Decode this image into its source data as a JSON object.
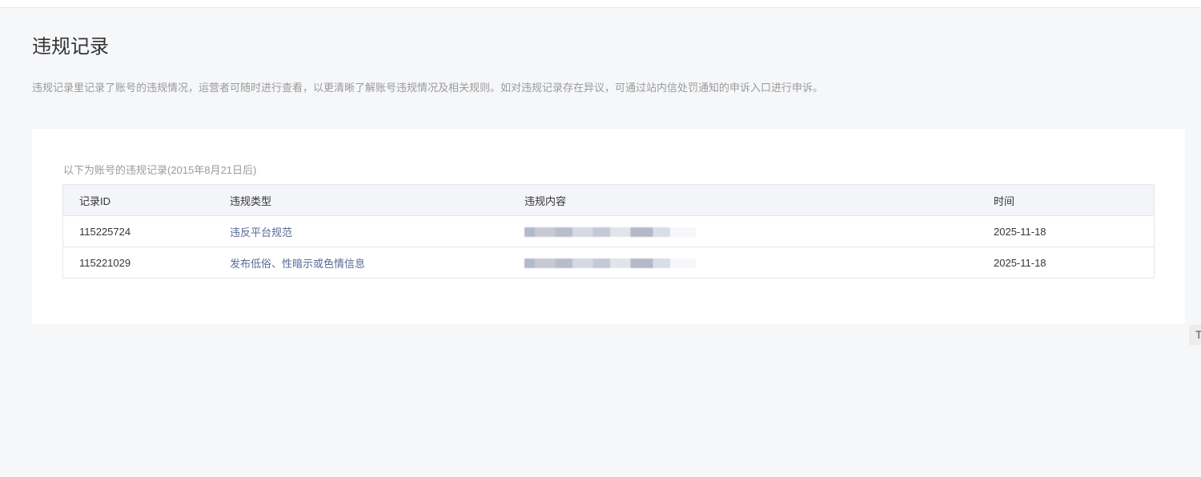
{
  "page": {
    "title": "违规记录",
    "description": "违规记录里记录了账号的违规情况，运营者可随时进行查看，以更清晰了解账号违规情况及相关规则。如对违规记录存在异议，可通过站内信处罚通知的申诉入口进行申诉。"
  },
  "records": {
    "caption": "以下为账号的违规记录(2015年8月21日后)",
    "columns": [
      "记录ID",
      "违规类型",
      "违规内容",
      "时间"
    ],
    "rows": [
      {
        "id": "115225724",
        "type": "违反平台规范",
        "date": "2025-11-18"
      },
      {
        "id": "115221029",
        "type": "发布低俗、性暗示或色情信息",
        "date": "2025-11-18"
      }
    ]
  },
  "side_widget": {
    "label": "T"
  }
}
